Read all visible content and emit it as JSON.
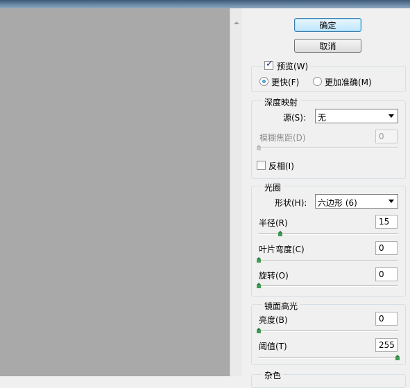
{
  "buttons": {
    "ok": "确定",
    "cancel": "取消"
  },
  "preview": {
    "label": "预览(W)",
    "checked": true,
    "faster": "更快(F)",
    "more_accurate": "更加准确(M)",
    "selected": "faster"
  },
  "depth_map": {
    "title": "深度映射",
    "source_label": "源(S):",
    "source_value": "无",
    "blur_focal_label": "模糊焦距(D)",
    "blur_focal_value": "0",
    "invert_label": "反相(I)",
    "invert_checked": false
  },
  "iris": {
    "title": "光圈",
    "shape_label": "形状(H):",
    "shape_value": "六边形 (6)",
    "radius_label": "半径(R)",
    "radius_value": "15",
    "blade_curvature_label": "叶片弯度(C)",
    "blade_curvature_value": "0",
    "rotation_label": "旋转(O)",
    "rotation_value": "0"
  },
  "specular": {
    "title": "镜面高光",
    "brightness_label": "亮度(B)",
    "brightness_value": "0",
    "threshold_label": "阈值(T)",
    "threshold_value": "255"
  },
  "noise": {
    "title": "杂色"
  },
  "colors": {
    "preview_bg": "#a9a9a9",
    "dialog_bg": "#f0f0f0",
    "slider_thumb": "#3f9b52"
  }
}
